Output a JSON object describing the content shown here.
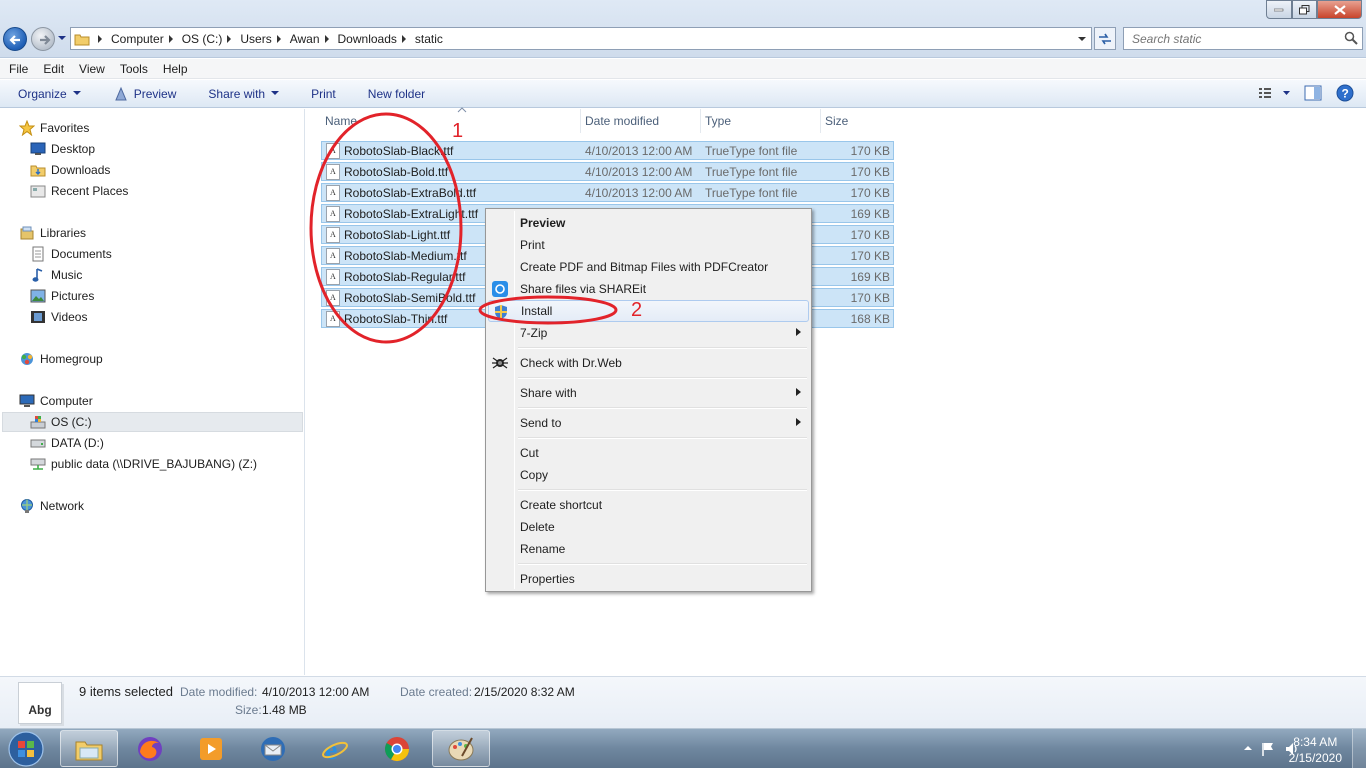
{
  "window": {
    "address_crumbs": [
      "Computer",
      "OS (C:)",
      "Users",
      "Awan",
      "Downloads",
      "static"
    ],
    "search_placeholder": "Search static"
  },
  "menubar": [
    "File",
    "Edit",
    "View",
    "Tools",
    "Help"
  ],
  "commandbar": {
    "organize": "Organize",
    "preview": "Preview",
    "share_with": "Share with",
    "print": "Print",
    "new_folder": "New folder"
  },
  "navpane": {
    "favorites": "Favorites",
    "desktop": "Desktop",
    "downloads": "Downloads",
    "recent_places": "Recent Places",
    "libraries": "Libraries",
    "documents": "Documents",
    "music": "Music",
    "pictures": "Pictures",
    "videos": "Videos",
    "homegroup": "Homegroup",
    "computer": "Computer",
    "os_c": "OS (C:)",
    "data_d": "DATA (D:)",
    "public_data": "public data (\\\\DRIVE_BAJUBANG) (Z:)",
    "network": "Network"
  },
  "columns": {
    "name": "Name",
    "date_modified": "Date modified",
    "type": "Type",
    "size": "Size"
  },
  "files": [
    {
      "name": "RobotoSlab-Black.ttf",
      "date": "4/10/2013 12:00 AM",
      "type": "TrueType font file",
      "size": "170 KB"
    },
    {
      "name": "RobotoSlab-Bold.ttf",
      "date": "4/10/2013 12:00 AM",
      "type": "TrueType font file",
      "size": "170 KB"
    },
    {
      "name": "RobotoSlab-ExtraBold.ttf",
      "date": "4/10/2013 12:00 AM",
      "type": "TrueType font file",
      "size": "170 KB"
    },
    {
      "name": "RobotoSlab-ExtraLight.ttf",
      "date": "",
      "type": "",
      "size": "169 KB"
    },
    {
      "name": "RobotoSlab-Light.ttf",
      "date": "",
      "type": "",
      "size": "170 KB"
    },
    {
      "name": "RobotoSlab-Medium.ttf",
      "date": "",
      "type": "",
      "size": "170 KB"
    },
    {
      "name": "RobotoSlab-Regular.ttf",
      "date": "",
      "type": "",
      "size": "169 KB"
    },
    {
      "name": "RobotoSlab-SemiBold.ttf",
      "date": "",
      "type": "",
      "size": "170 KB"
    },
    {
      "name": "RobotoSlab-Thin.ttf",
      "date": "",
      "type": "",
      "size": "168 KB"
    }
  ],
  "context_menu": {
    "preview": "Preview",
    "print": "Print",
    "create_pdf": "Create PDF and Bitmap Files with PDFCreator",
    "shareit": "Share files via SHAREit",
    "install": "Install",
    "seven_zip": "7-Zip",
    "drweb": "Check with Dr.Web",
    "share_with": "Share with",
    "send_to": "Send to",
    "cut": "Cut",
    "copy": "Copy",
    "create_shortcut": "Create shortcut",
    "delete": "Delete",
    "rename": "Rename",
    "properties": "Properties"
  },
  "annotations": {
    "num1": "1",
    "num2": "2",
    "color": "#e2232a"
  },
  "details": {
    "thumb_text": "Abg",
    "selected": "9 items selected",
    "date_modified_label": "Date modified:",
    "date_modified_value": "4/10/2013 12:00 AM",
    "date_created_label": "Date created:",
    "date_created_value": "2/15/2020 8:32 AM",
    "size_label": "Size:",
    "size_value": "1.48 MB"
  },
  "taskbar": {
    "apps": [
      "windows-explorer",
      "firefox",
      "media-player",
      "thunderbird",
      "internet-explorer",
      "chrome",
      "paint"
    ],
    "time": "8:34 AM",
    "date": "2/15/2020"
  }
}
